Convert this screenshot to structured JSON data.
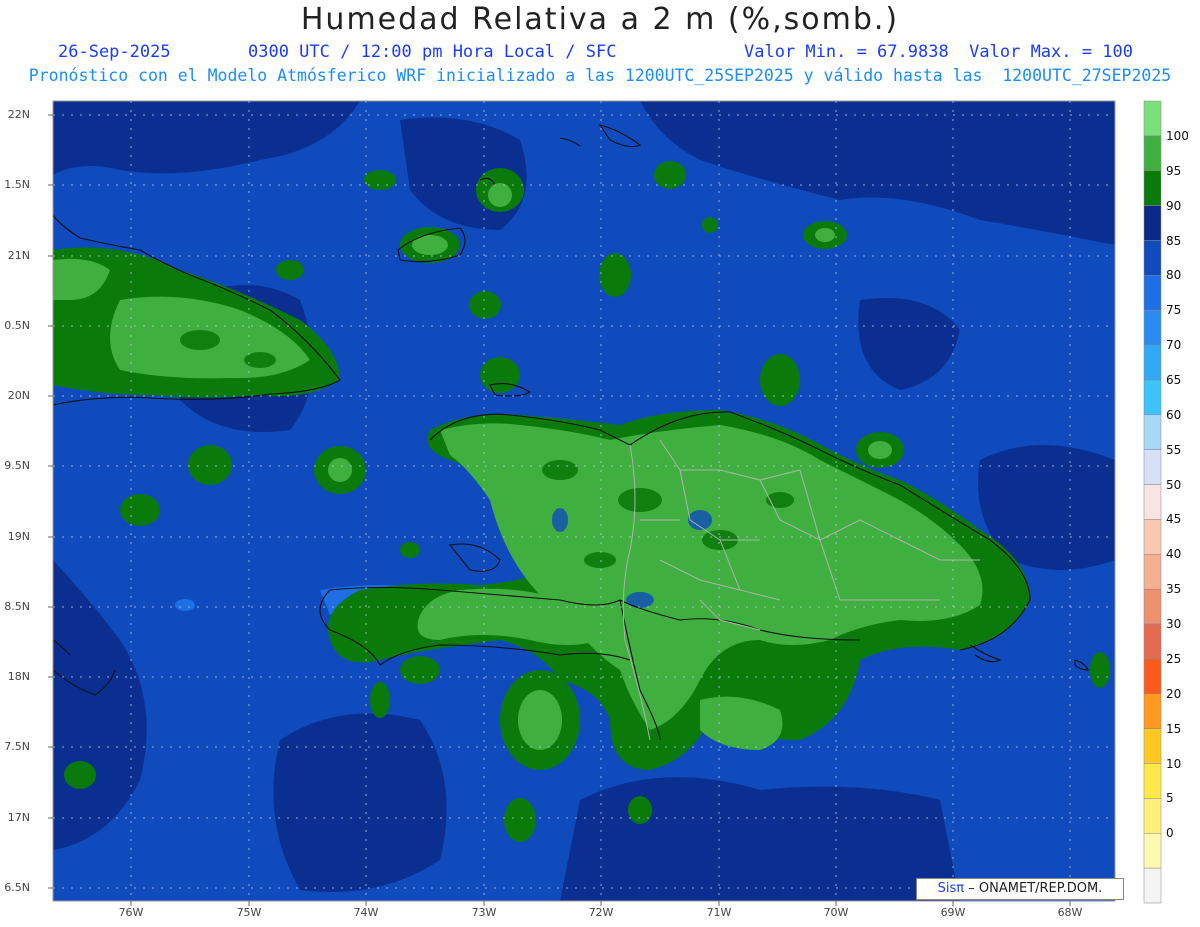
{
  "title": "Humedad Relativa a 2 m (%,somb.)",
  "header": {
    "date": "26-Sep-2025",
    "time": "0300 UTC / 12:00 pm Hora Local / SFC",
    "minmax": "Valor Min. = 67.9838  Valor Max. = 100",
    "subtitle": "Pronóstico con el Modelo Atmósferico WRF inicializado a las 1200UTC_25SEP2025 y válido hasta las  1200UTC_27SEP2025"
  },
  "axes": {
    "lat_labels": [
      "22N",
      "1.5N",
      "21N",
      "0.5N",
      "20N",
      "9.5N",
      "19N",
      "8.5N",
      "18N",
      "7.5N",
      "17N",
      "6.5N"
    ],
    "lon_labels": [
      "76W",
      "75W",
      "74W",
      "73W",
      "72W",
      "71W",
      "70W",
      "69W",
      "68W"
    ]
  },
  "colorbar": {
    "labels": [
      "100",
      "95",
      "90",
      "85",
      "80",
      "75",
      "70",
      "65",
      "60",
      "55",
      "50",
      "45",
      "40",
      "35",
      "30",
      "25",
      "20",
      "15",
      "10",
      "5",
      "0"
    ],
    "colors": [
      "#7be07b",
      "#3fb03f",
      "#0a7a0a",
      "#0a2a8a",
      "#0f4bbd",
      "#1e6fe6",
      "#2a8cf0",
      "#31a8f5",
      "#3cc4fa",
      "#a8d8f8",
      "#d8e0f8",
      "#f8e4e4",
      "#f8c8b0",
      "#f4b090",
      "#ec9070",
      "#e46a50",
      "#ff5a1e",
      "#ff9a1e",
      "#ffc81e",
      "#ffe84a",
      "#fff07a",
      "#fff8b0",
      "#f4f4f4"
    ]
  },
  "legend_colors": {
    "sea_low": "#0f4bbd",
    "sea_high": "#0a2a8a",
    "land_green": "#3fb03f",
    "land_dark": "#0a7a0a",
    "patch_blue": "#1e6fe6"
  },
  "credit": {
    "sis": "Sisπ",
    "org": "– ONAMET/REP.DOM."
  }
}
